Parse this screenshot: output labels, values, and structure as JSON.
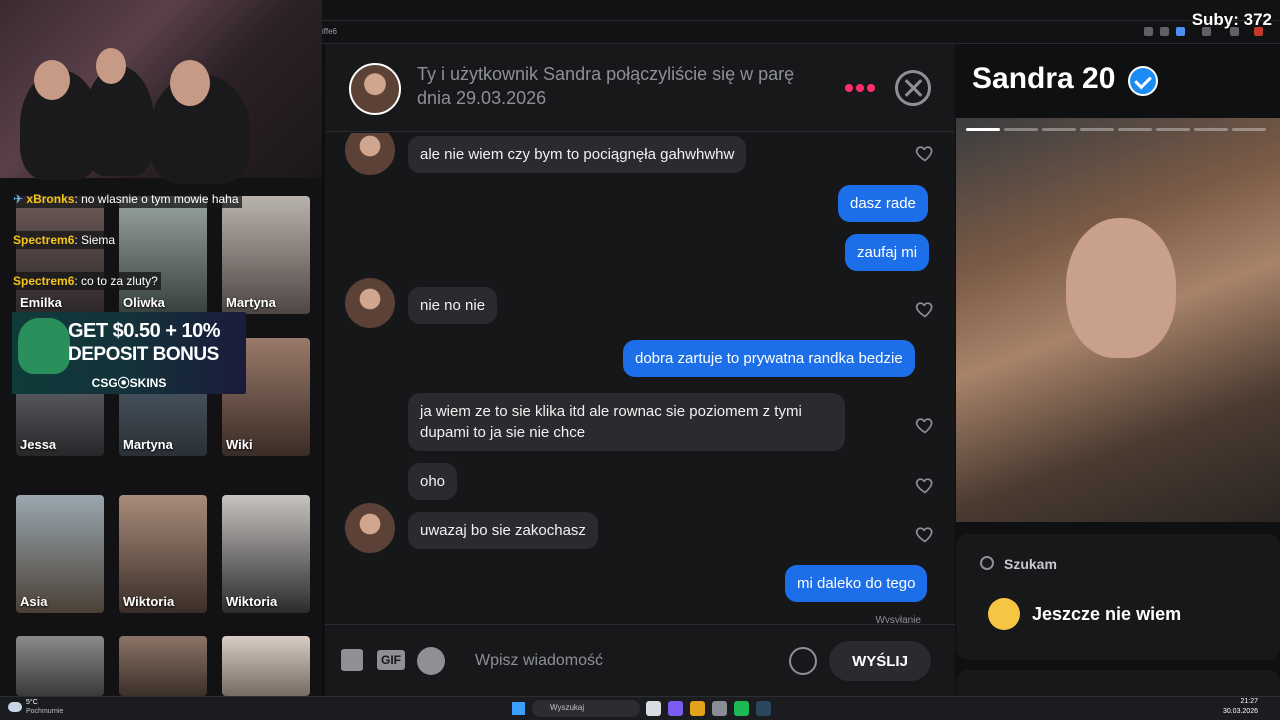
{
  "overlay": {
    "subs": "Suby: 372"
  },
  "browser": {
    "url_fragment": "iffe6"
  },
  "stream_chat": [
    {
      "user": "xBronks",
      "message": "no wlasnie o tym mowie haha"
    },
    {
      "user": "Spectrem6",
      "message": "Siema"
    },
    {
      "user": "Spectrem6",
      "message": "co to za zluty?"
    }
  ],
  "tiles": [
    {
      "name": "Emilka"
    },
    {
      "name": "Oliwka"
    },
    {
      "name": "Martyna"
    },
    {
      "name": "Jessa"
    },
    {
      "name": "Martyna"
    },
    {
      "name": "Wiki"
    },
    {
      "name": "Asia"
    },
    {
      "name": "Wiktoria"
    },
    {
      "name": "Wiktoria"
    },
    {
      "name": ""
    },
    {
      "name": ""
    },
    {
      "name": ""
    }
  ],
  "promo": {
    "line1": "GET $0.50 + 10%",
    "line2": "DEPOSIT BONUS",
    "brand": "CSG⦿SKINS"
  },
  "chat": {
    "header": "Ty i użytkownik Sandra połączyliście się w parę dnia 29.03.2026",
    "messages": [
      {
        "dir": "in",
        "text": "ale nie wiem czy bym to pociągnęła gahwhwhw"
      },
      {
        "dir": "out",
        "text": "dasz rade"
      },
      {
        "dir": "out",
        "text": "zaufaj mi"
      },
      {
        "dir": "in",
        "text": "nie no nie"
      },
      {
        "dir": "out",
        "text": "dobra zartuje to prywatna randka bedzie"
      },
      {
        "dir": "in",
        "text": "ja wiem ze to sie klika itd ale rownac sie poziomem z tymi dupami to ja sie nie chce"
      },
      {
        "dir": "in",
        "text": "oho"
      },
      {
        "dir": "in",
        "text": "uwazaj bo sie zakochasz"
      },
      {
        "dir": "out",
        "text": "mi daleko do tego"
      }
    ],
    "sending": "Wysyłanie",
    "composer": {
      "gif": "GIF",
      "placeholder": "Wpisz wiadomość",
      "send": "WYŚLIJ"
    }
  },
  "profile": {
    "name": "Sandra 20",
    "seeking_label": "Szukam",
    "seeking_value": "Jeszcze nie wiem"
  },
  "taskbar": {
    "weather_temp": "5°C",
    "weather_desc": "Pochmurnie",
    "search_placeholder": "Wyszukaj",
    "time": "21:27",
    "date": "30.03.2026"
  },
  "colors": {
    "accent_blue": "#1c6fe8",
    "accent_pink": "#ff2e6a",
    "verified": "#1c8cf5"
  }
}
